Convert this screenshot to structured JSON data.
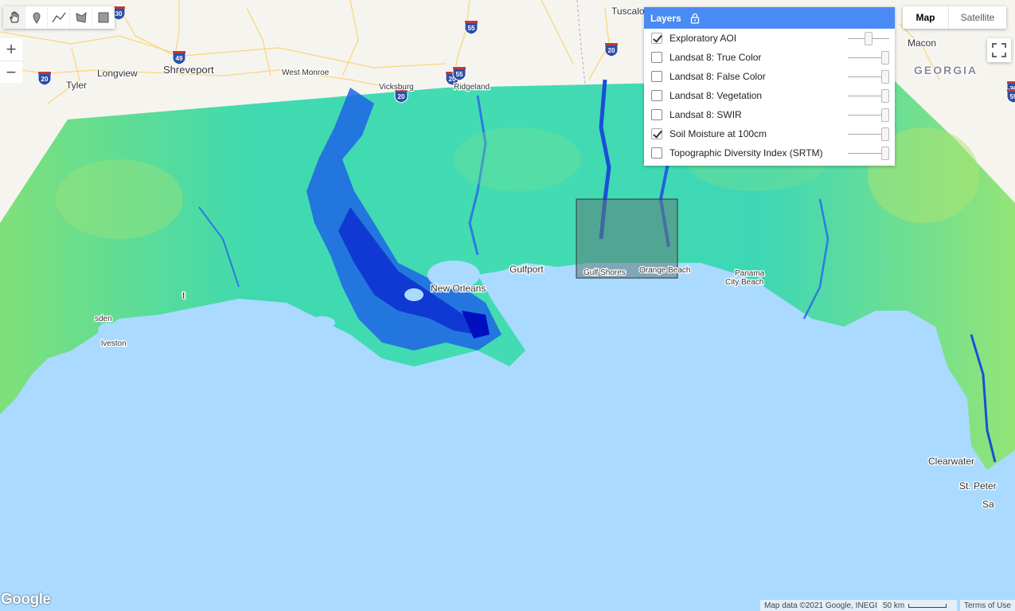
{
  "toolbar": {
    "tools": [
      {
        "icon": "hand-icon",
        "name": "pan"
      },
      {
        "icon": "marker-icon",
        "name": "point"
      },
      {
        "icon": "line-icon",
        "name": "line"
      },
      {
        "icon": "polygon-icon",
        "name": "polygon"
      },
      {
        "icon": "rectangle-icon",
        "name": "rectangle"
      }
    ]
  },
  "zoom": {
    "in_label": "+",
    "out_label": "−"
  },
  "map_type": {
    "map_label": "Map",
    "satellite_label": "Satellite",
    "active": "Map"
  },
  "layers": {
    "title": "Layers",
    "items": [
      {
        "label": "Exploratory AOI",
        "checked": true,
        "opacity": 0.5
      },
      {
        "label": "Landsat 8: True Color",
        "checked": false,
        "opacity": 1
      },
      {
        "label": "Landsat 8: False Color",
        "checked": false,
        "opacity": 1
      },
      {
        "label": "Landsat 8: Vegetation",
        "checked": false,
        "opacity": 1
      },
      {
        "label": "Landsat 8: SWIR",
        "checked": false,
        "opacity": 1
      },
      {
        "label": "Soil Moisture at 100cm",
        "checked": true,
        "opacity": 1
      },
      {
        "label": "Topographic Diversity Index (SRTM)",
        "checked": false,
        "opacity": 1
      }
    ]
  },
  "map_labels": {
    "cities": [
      {
        "name": "Shreveport",
        "size": "l"
      },
      {
        "name": "Longview",
        "size": "m"
      },
      {
        "name": "Tyler",
        "size": "m"
      },
      {
        "name": "West Monroe",
        "size": "s"
      },
      {
        "name": "Vicksburg",
        "size": "s"
      },
      {
        "name": "Ridgeland",
        "size": "s"
      },
      {
        "name": "Tuscalo",
        "size": "m"
      },
      {
        "name": "Macon",
        "size": "m"
      },
      {
        "name": "GEORGIA",
        "size": "state"
      },
      {
        "name": "Gulfport",
        "size": "m"
      },
      {
        "name": "New Orleans",
        "size": "m"
      },
      {
        "name": "Gulf Shores",
        "size": "s"
      },
      {
        "name": "Orange Beach",
        "size": "s"
      },
      {
        "name": "Panama",
        "size": "s"
      },
      {
        "name": "City Beach",
        "size": "s"
      },
      {
        "name": "Clearwater",
        "size": "m"
      },
      {
        "name": "St. Peter",
        "size": "m"
      },
      {
        "name": "Sa",
        "size": "m"
      },
      {
        "name": "sden",
        "size": "s"
      },
      {
        "name": "lveston",
        "size": "s"
      },
      {
        "name": "t",
        "size": "m"
      }
    ],
    "shields": [
      "30",
      "49",
      "20",
      "55",
      "20",
      "20",
      "20",
      "55",
      "20",
      "59"
    ]
  },
  "footer": {
    "logo": "Google",
    "map_data": "Map data ©2021 Google, INEGI",
    "scale_label": "50 km",
    "terms": "Terms of Use"
  },
  "colors": {
    "water": "#aadaff",
    "land": "#f6f4ef",
    "panel_header": "#4a8af4",
    "moisture_low": "#b4e36a",
    "moisture_mid": "#35d6c8",
    "moisture_high": "#0010c0",
    "aoi_fill": "#5f7c78"
  }
}
